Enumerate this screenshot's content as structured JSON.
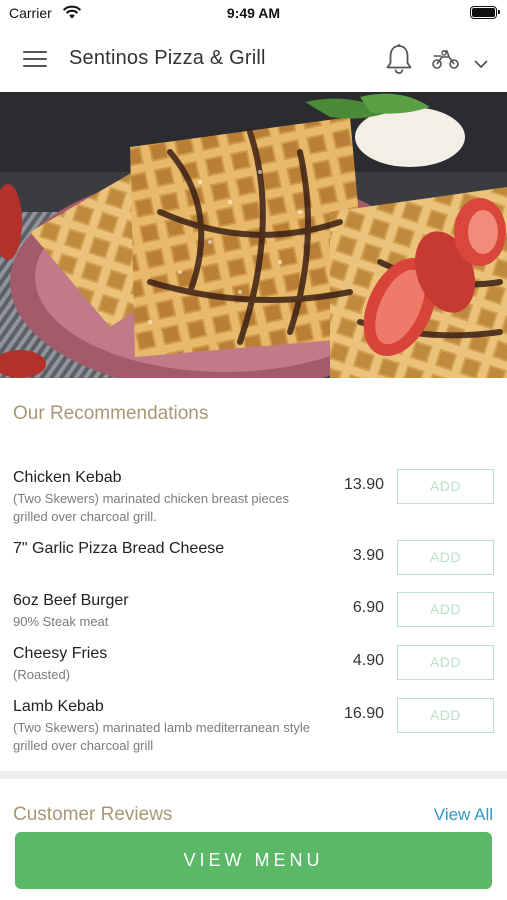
{
  "status_bar": {
    "carrier": "Carrier",
    "time": "9:49 AM"
  },
  "header": {
    "title": "Sentinos Pizza & Grill",
    "icons": [
      "menu-icon",
      "bell-icon",
      "scooter-icon",
      "chevron-down-icon"
    ]
  },
  "hero": {
    "description_icon": "waffle-photo"
  },
  "recommendations": {
    "title": "Our Recommendations",
    "add_label": "ADD",
    "items": [
      {
        "name": "Chicken Kebab",
        "desc": "(Two Skewers) marinated chicken breast pieces grilled over charcoal grill.",
        "price": "13.90"
      },
      {
        "name": "7\" Garlic Pizza Bread Cheese",
        "desc": "",
        "price": "3.90"
      },
      {
        "name": "6oz Beef Burger",
        "desc": "90% Steak meat",
        "price": "6.90"
      },
      {
        "name": "Cheesy Fries",
        "desc": "(Roasted)",
        "price": "4.90"
      },
      {
        "name": "Lamb Kebab",
        "desc": "(Two Skewers) marinated lamb mediterranean style grilled over charcoal grill",
        "price": "16.90"
      }
    ]
  },
  "reviews": {
    "title": "Customer Reviews",
    "view_all": "View All"
  },
  "cta": {
    "label": "VIEW MENU"
  },
  "colors": {
    "accent_green": "#5ab866",
    "add_border": "#b9e1c6",
    "section_title": "#a99775",
    "link_blue": "#2f98c8"
  }
}
